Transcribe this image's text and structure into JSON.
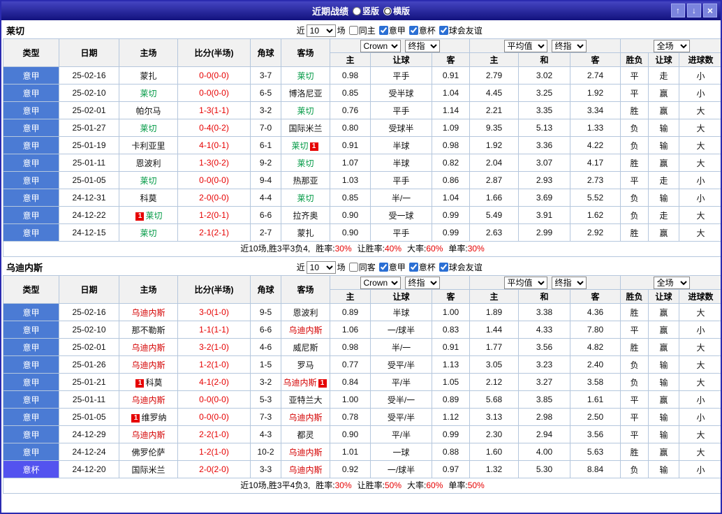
{
  "titlebar": {
    "title": "近期战绩",
    "view_modes": [
      {
        "label": "竖版",
        "selected": false
      },
      {
        "label": "横版",
        "selected": true
      }
    ],
    "up_button": "↑",
    "down_button": "↓",
    "close_button": "×"
  },
  "filter_bar": {
    "near_label": "近",
    "count_value": "10",
    "unit_label": "场"
  },
  "table_header": {
    "static_cols": [
      "类型",
      "日期",
      "主场",
      "比分(半场)",
      "角球",
      "客场"
    ],
    "odds_selects": [
      "Crown",
      "终指"
    ],
    "avg_selects": [
      "平均值",
      "终指"
    ],
    "result_selects": [
      "全场"
    ],
    "sub_cols": [
      "主",
      "让球",
      "客",
      "主",
      "和",
      "客",
      "胜负",
      "让球",
      "进球数"
    ]
  },
  "colors": {
    "win": "#e60000",
    "draw_green": "#009933",
    "loss_blue": "#2222cc",
    "seriea_badge_bg": "#4b7bd4",
    "cup_badge_bg": "#5353ef",
    "lecce_team": "#009944",
    "udinese_team": "#d40000",
    "score_red": "#e60000"
  },
  "sections": [
    {
      "team": "莱切",
      "team_color": "#009944",
      "filters": [
        {
          "label": "同主",
          "checked": false
        },
        {
          "label": "意甲",
          "checked": true
        },
        {
          "label": "意杯",
          "checked": true
        },
        {
          "label": "球会友谊",
          "checked": true
        }
      ],
      "rows": [
        {
          "league": "意甲",
          "date": "25-02-16",
          "home": "蒙扎",
          "home_card": "",
          "home_focus": false,
          "score": "0-0(0-0)",
          "corners": "3-7",
          "away": "莱切",
          "away_card": "",
          "away_focus": true,
          "odds": [
            "0.98",
            "平手",
            "0.91"
          ],
          "avg": [
            "2.79",
            "3.02",
            "2.74"
          ],
          "outcome": "平",
          "handicap": "走",
          "goals": "小"
        },
        {
          "league": "意甲",
          "date": "25-02-10",
          "home": "莱切",
          "home_card": "",
          "home_focus": true,
          "score": "0-0(0-0)",
          "corners": "6-5",
          "away": "博洛尼亚",
          "away_card": "",
          "away_focus": false,
          "odds": [
            "0.85",
            "受半球",
            "1.04"
          ],
          "avg": [
            "4.45",
            "3.25",
            "1.92"
          ],
          "outcome": "平",
          "handicap": "赢",
          "goals": "小"
        },
        {
          "league": "意甲",
          "date": "25-02-01",
          "home": "帕尔马",
          "home_card": "",
          "home_focus": false,
          "score": "1-3(1-1)",
          "corners": "3-2",
          "away": "莱切",
          "away_card": "",
          "away_focus": true,
          "odds": [
            "0.76",
            "平手",
            "1.14"
          ],
          "avg": [
            "2.21",
            "3.35",
            "3.34"
          ],
          "outcome": "胜",
          "handicap": "赢",
          "goals": "大"
        },
        {
          "league": "意甲",
          "date": "25-01-27",
          "home": "莱切",
          "home_card": "",
          "home_focus": true,
          "score": "0-4(0-2)",
          "corners": "7-0",
          "away": "国际米兰",
          "away_card": "",
          "away_focus": false,
          "odds": [
            "0.80",
            "受球半",
            "1.09"
          ],
          "avg": [
            "9.35",
            "5.13",
            "1.33"
          ],
          "outcome": "负",
          "handicap": "输",
          "goals": "大"
        },
        {
          "league": "意甲",
          "date": "25-01-19",
          "home": "卡利亚里",
          "home_card": "",
          "home_focus": false,
          "score": "4-1(0-1)",
          "corners": "6-1",
          "away": "莱切",
          "away_card": "1",
          "away_focus": true,
          "odds": [
            "0.91",
            "半球",
            "0.98"
          ],
          "avg": [
            "1.92",
            "3.36",
            "4.22"
          ],
          "outcome": "负",
          "handicap": "输",
          "goals": "大"
        },
        {
          "league": "意甲",
          "date": "25-01-11",
          "home": "恩波利",
          "home_card": "",
          "home_focus": false,
          "score": "1-3(0-2)",
          "corners": "9-2",
          "away": "莱切",
          "away_card": "",
          "away_focus": true,
          "odds": [
            "1.07",
            "半球",
            "0.82"
          ],
          "avg": [
            "2.04",
            "3.07",
            "4.17"
          ],
          "outcome": "胜",
          "handicap": "赢",
          "goals": "大"
        },
        {
          "league": "意甲",
          "date": "25-01-05",
          "home": "莱切",
          "home_card": "",
          "home_focus": true,
          "score": "0-0(0-0)",
          "corners": "9-4",
          "away": "热那亚",
          "away_card": "",
          "away_focus": false,
          "odds": [
            "1.03",
            "平手",
            "0.86"
          ],
          "avg": [
            "2.87",
            "2.93",
            "2.73"
          ],
          "outcome": "平",
          "handicap": "走",
          "goals": "小"
        },
        {
          "league": "意甲",
          "date": "24-12-31",
          "home": "科莫",
          "home_card": "",
          "home_focus": false,
          "score": "2-0(0-0)",
          "corners": "4-4",
          "away": "莱切",
          "away_card": "",
          "away_focus": true,
          "odds": [
            "0.85",
            "半/一",
            "1.04"
          ],
          "avg": [
            "1.66",
            "3.69",
            "5.52"
          ],
          "outcome": "负",
          "handicap": "输",
          "goals": "小"
        },
        {
          "league": "意甲",
          "date": "24-12-22",
          "home": "莱切",
          "home_card": "1",
          "home_focus": true,
          "score": "1-2(0-1)",
          "corners": "6-6",
          "away": "拉齐奥",
          "away_card": "",
          "away_focus": false,
          "odds": [
            "0.90",
            "受一球",
            "0.99"
          ],
          "avg": [
            "5.49",
            "3.91",
            "1.62"
          ],
          "outcome": "负",
          "handicap": "走",
          "goals": "大"
        },
        {
          "league": "意甲",
          "date": "24-12-15",
          "home": "莱切",
          "home_card": "",
          "home_focus": true,
          "score": "2-1(2-1)",
          "corners": "2-7",
          "away": "蒙扎",
          "away_card": "",
          "away_focus": false,
          "odds": [
            "0.90",
            "平手",
            "0.99"
          ],
          "avg": [
            "2.63",
            "2.99",
            "2.92"
          ],
          "outcome": "胜",
          "handicap": "赢",
          "goals": "大"
        }
      ],
      "summary": {
        "record": "近10场,胜3平3负4,",
        "stats": [
          {
            "label": "胜率:",
            "value": "30%"
          },
          {
            "label": "让胜率:",
            "value": "40%"
          },
          {
            "label": "大率:",
            "value": "60%"
          },
          {
            "label": "单率:",
            "value": "30%"
          }
        ]
      }
    },
    {
      "team": "乌迪内斯",
      "team_color": "#d40000",
      "filters": [
        {
          "label": "同客",
          "checked": false
        },
        {
          "label": "意甲",
          "checked": true
        },
        {
          "label": "意杯",
          "checked": true
        },
        {
          "label": "球会友谊",
          "checked": true
        }
      ],
      "rows": [
        {
          "league": "意甲",
          "date": "25-02-16",
          "home": "乌迪内斯",
          "home_card": "",
          "home_focus": true,
          "score": "3-0(1-0)",
          "corners": "9-5",
          "away": "恩波利",
          "away_card": "",
          "away_focus": false,
          "odds": [
            "0.89",
            "半球",
            "1.00"
          ],
          "avg": [
            "1.89",
            "3.38",
            "4.36"
          ],
          "outcome": "胜",
          "handicap": "赢",
          "goals": "大"
        },
        {
          "league": "意甲",
          "date": "25-02-10",
          "home": "那不勒斯",
          "home_card": "",
          "home_focus": false,
          "score": "1-1(1-1)",
          "corners": "6-6",
          "away": "乌迪内斯",
          "away_card": "",
          "away_focus": true,
          "odds": [
            "1.06",
            "一/球半",
            "0.83"
          ],
          "avg": [
            "1.44",
            "4.33",
            "7.80"
          ],
          "outcome": "平",
          "handicap": "赢",
          "goals": "小"
        },
        {
          "league": "意甲",
          "date": "25-02-01",
          "home": "乌迪内斯",
          "home_card": "",
          "home_focus": true,
          "score": "3-2(1-0)",
          "corners": "4-6",
          "away": "威尼斯",
          "away_card": "",
          "away_focus": false,
          "odds": [
            "0.98",
            "半/一",
            "0.91"
          ],
          "avg": [
            "1.77",
            "3.56",
            "4.82"
          ],
          "outcome": "胜",
          "handicap": "赢",
          "goals": "大"
        },
        {
          "league": "意甲",
          "date": "25-01-26",
          "home": "乌迪内斯",
          "home_card": "",
          "home_focus": true,
          "score": "1-2(1-0)",
          "corners": "1-5",
          "away": "罗马",
          "away_card": "",
          "away_focus": false,
          "odds": [
            "0.77",
            "受平/半",
            "1.13"
          ],
          "avg": [
            "3.05",
            "3.23",
            "2.40"
          ],
          "outcome": "负",
          "handicap": "输",
          "goals": "大"
        },
        {
          "league": "意甲",
          "date": "25-01-21",
          "home": "科莫",
          "home_card": "1",
          "home_focus": false,
          "score": "4-1(2-0)",
          "corners": "3-2",
          "away": "乌迪内斯",
          "away_card": "1",
          "away_focus": true,
          "odds": [
            "0.84",
            "平/半",
            "1.05"
          ],
          "avg": [
            "2.12",
            "3.27",
            "3.58"
          ],
          "outcome": "负",
          "handicap": "输",
          "goals": "大"
        },
        {
          "league": "意甲",
          "date": "25-01-11",
          "home": "乌迪内斯",
          "home_card": "",
          "home_focus": true,
          "score": "0-0(0-0)",
          "corners": "5-3",
          "away": "亚特兰大",
          "away_card": "",
          "away_focus": false,
          "odds": [
            "1.00",
            "受半/一",
            "0.89"
          ],
          "avg": [
            "5.68",
            "3.85",
            "1.61"
          ],
          "outcome": "平",
          "handicap": "赢",
          "goals": "小"
        },
        {
          "league": "意甲",
          "date": "25-01-05",
          "home": "维罗纳",
          "home_card": "1",
          "home_focus": false,
          "score": "0-0(0-0)",
          "corners": "7-3",
          "away": "乌迪内斯",
          "away_card": "",
          "away_focus": true,
          "odds": [
            "0.78",
            "受平/半",
            "1.12"
          ],
          "avg": [
            "3.13",
            "2.98",
            "2.50"
          ],
          "outcome": "平",
          "handicap": "输",
          "goals": "小"
        },
        {
          "league": "意甲",
          "date": "24-12-29",
          "home": "乌迪内斯",
          "home_card": "",
          "home_focus": true,
          "score": "2-2(1-0)",
          "corners": "4-3",
          "away": "都灵",
          "away_card": "",
          "away_focus": false,
          "odds": [
            "0.90",
            "平/半",
            "0.99"
          ],
          "avg": [
            "2.30",
            "2.94",
            "3.56"
          ],
          "outcome": "平",
          "handicap": "输",
          "goals": "大"
        },
        {
          "league": "意甲",
          "date": "24-12-24",
          "home": "佛罗伦萨",
          "home_card": "",
          "home_focus": false,
          "score": "1-2(1-0)",
          "corners": "10-2",
          "away": "乌迪内斯",
          "away_card": "",
          "away_focus": true,
          "odds": [
            "1.01",
            "一球",
            "0.88"
          ],
          "avg": [
            "1.60",
            "4.00",
            "5.63"
          ],
          "outcome": "胜",
          "handicap": "赢",
          "goals": "大"
        },
        {
          "league": "意杯",
          "date": "24-12-20",
          "home": "国际米兰",
          "home_card": "",
          "home_focus": false,
          "score": "2-0(2-0)",
          "corners": "3-3",
          "away": "乌迪内斯",
          "away_card": "",
          "away_focus": true,
          "odds": [
            "0.92",
            "一/球半",
            "0.97"
          ],
          "avg": [
            "1.32",
            "5.30",
            "8.84"
          ],
          "outcome": "负",
          "handicap": "输",
          "goals": "小"
        }
      ],
      "summary": {
        "record": "近10场,胜3平4负3,",
        "stats": [
          {
            "label": "胜率:",
            "value": "30%"
          },
          {
            "label": "让胜率:",
            "value": "50%"
          },
          {
            "label": "大率:",
            "value": "60%"
          },
          {
            "label": "单率:",
            "value": "50%"
          }
        ]
      }
    }
  ]
}
